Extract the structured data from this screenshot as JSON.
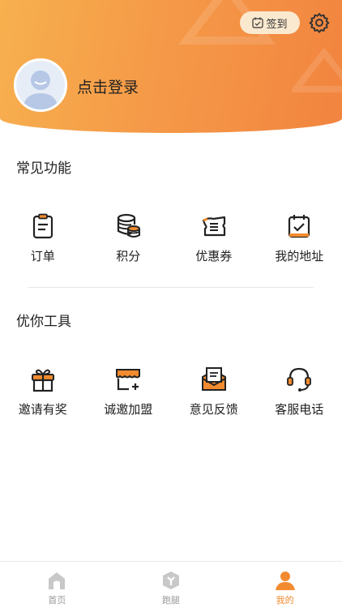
{
  "header": {
    "checkin_label": "签到",
    "login_label": "点击登录",
    "gradient_colors": [
      "#f7b04e",
      "#f2843f"
    ]
  },
  "common": {
    "title": "常见功能",
    "items": [
      {
        "label": "订单",
        "icon": "clipboard-icon"
      },
      {
        "label": "积分",
        "icon": "coins-icon"
      },
      {
        "label": "优惠券",
        "icon": "ticket-icon"
      },
      {
        "label": "我的地址",
        "icon": "check-box-icon"
      }
    ]
  },
  "tools": {
    "title": "优你工具",
    "items": [
      {
        "label": "邀请有奖",
        "icon": "gift-icon"
      },
      {
        "label": "诚邀加盟",
        "icon": "storefront-icon"
      },
      {
        "label": "意见反馈",
        "icon": "envelope-icon"
      },
      {
        "label": "客服电话",
        "icon": "headset-icon"
      }
    ]
  },
  "tabbar": {
    "items": [
      {
        "label": "首页",
        "icon": "home-icon",
        "active": false
      },
      {
        "label": "跑腿",
        "icon": "errand-icon",
        "active": false
      },
      {
        "label": "我的",
        "icon": "user-icon",
        "active": true
      }
    ],
    "active_color": "#f28b2f",
    "inactive_color": "#999999"
  },
  "accent_color": "#f28b2f"
}
